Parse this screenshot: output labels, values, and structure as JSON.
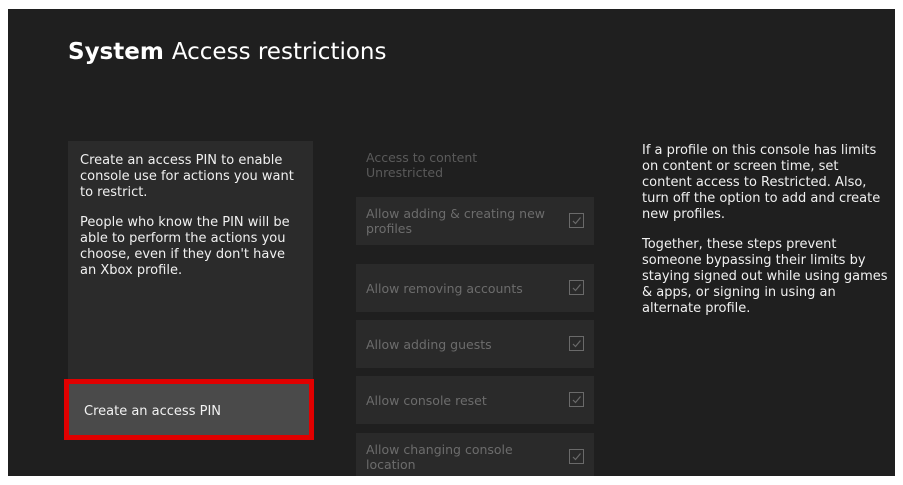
{
  "header": {
    "section": "System",
    "title": "Access restrictions"
  },
  "intro": {
    "paragraph_1": "Create an access PIN to enable console use for actions you want to restrict.",
    "paragraph_2": "People who know the PIN will be able to perform the actions you choose, even if they don't have an Xbox profile."
  },
  "pin_button": {
    "label": "Create an access PIN"
  },
  "options": {
    "header": "Access to content Unrestricted",
    "items": [
      {
        "label": "Allow adding & creating new profiles",
        "checked": true
      },
      {
        "label": "Allow removing accounts",
        "checked": true
      },
      {
        "label": "Allow adding guests",
        "checked": true
      },
      {
        "label": "Allow console reset",
        "checked": true
      },
      {
        "label": "Allow changing console location",
        "checked": true
      }
    ]
  },
  "help": {
    "paragraph_1": "If a profile on this console has limits on content or screen time, set content access to Restricted. Also, turn off the option to add and create new profiles.",
    "paragraph_2": "Together, these steps prevent someone bypassing their limits by staying signed out while using games & apps, or signing in using an alternate profile."
  },
  "colors": {
    "background": "#1f1f1f",
    "highlight_border": "#e00000",
    "disabled_text": "#6c6c6c"
  }
}
